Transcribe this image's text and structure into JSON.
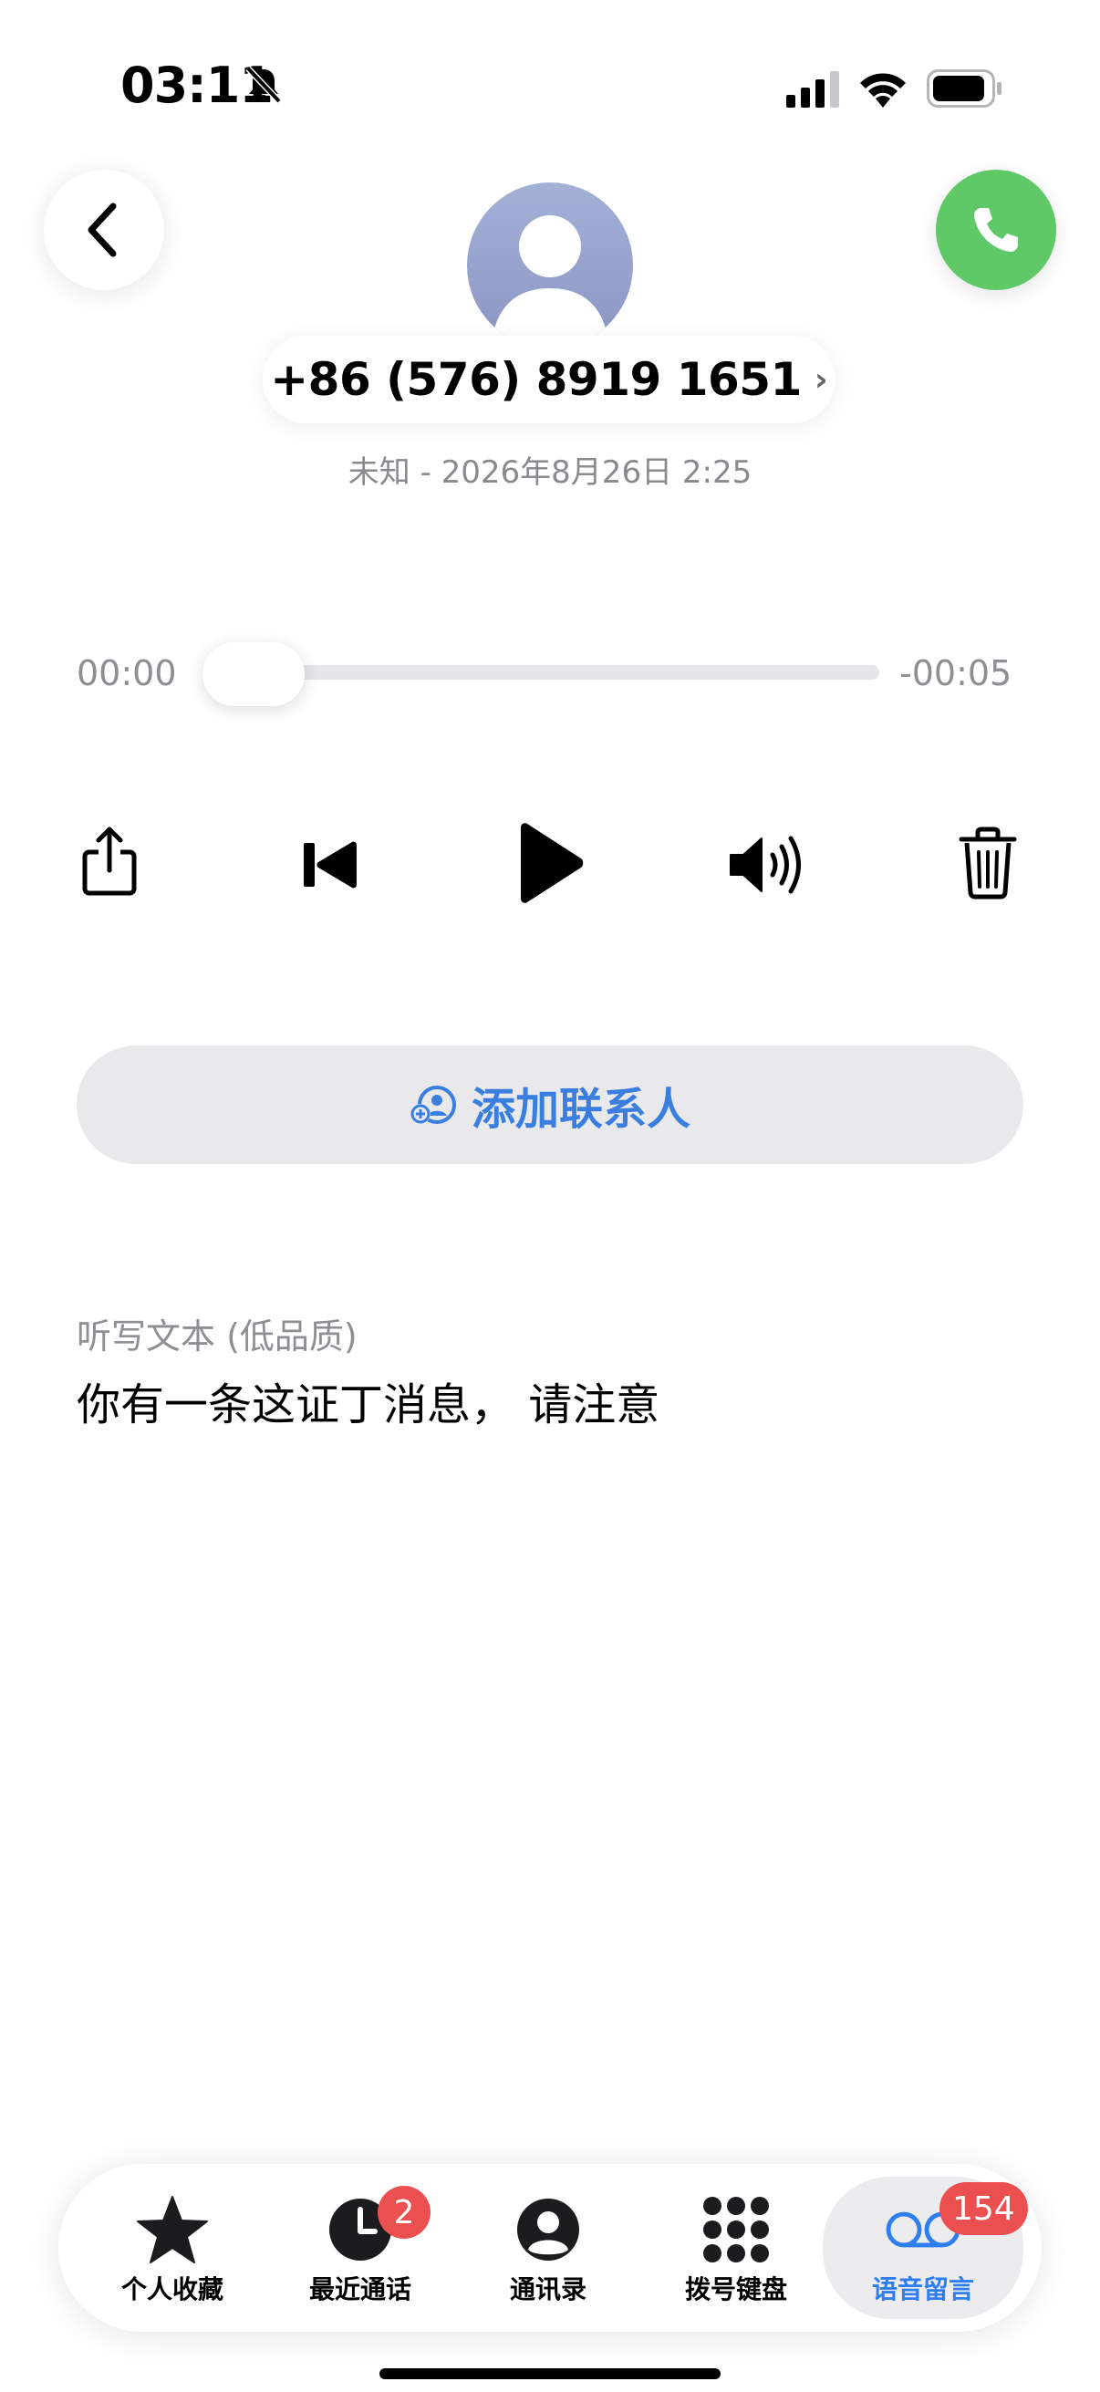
{
  "status_bar": {
    "time": "03:11",
    "icons": [
      "bell-off-icon",
      "signal-icon",
      "wifi-icon",
      "battery-icon"
    ]
  },
  "header": {
    "phone_number": "+86 (576) 8919 1651",
    "chevron": "›",
    "subtitle": "未知 - 2026年8月26日 2:25"
  },
  "player": {
    "elapsed": "00:00",
    "remaining": "-00:05",
    "progress": 0
  },
  "actions": {
    "add_contact": "添加联系人"
  },
  "transcript": {
    "title": "听写文本 (低品质)",
    "text": "你有一条这证丁消息， 请注意"
  },
  "tabs": [
    {
      "label": "个人收藏",
      "icon": "star-icon",
      "badge": ""
    },
    {
      "label": "最近通话",
      "icon": "clock-icon",
      "badge": "2"
    },
    {
      "label": "通讯录",
      "icon": "person-circle-icon",
      "badge": ""
    },
    {
      "label": "拨号键盘",
      "icon": "keypad-icon",
      "badge": ""
    },
    {
      "label": "语音留言",
      "icon": "voicemail-icon",
      "badge": "154"
    }
  ],
  "colors": {
    "accent": "#2f7ef0",
    "call_green": "#5fc867",
    "badge_red": "#ec4f4f",
    "secondary_text": "#8e8e93"
  }
}
